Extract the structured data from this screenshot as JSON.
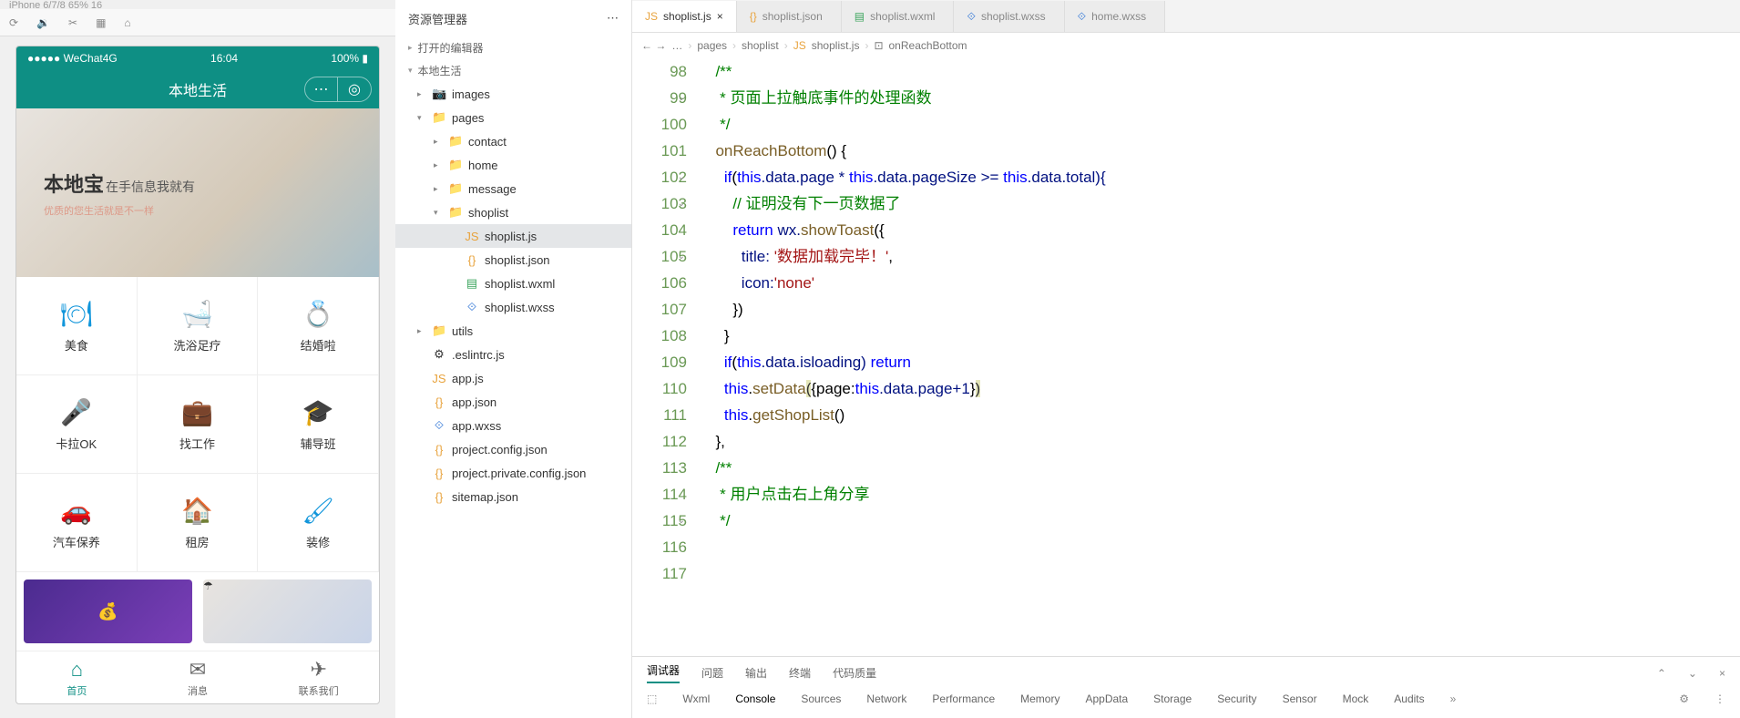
{
  "simulator": {
    "device_label": "iPhone 6/7/8 65% 16",
    "status_left": "●●●●● WeChat4G",
    "status_time": "16:04",
    "status_right": "100% ▮",
    "app_title": "本地生活",
    "banner": {
      "title": "本地宝",
      "sub": "在手信息我就有",
      "desc": "优质的您生活就是不一样"
    },
    "grid": [
      {
        "icon": "🍽",
        "label": "美食"
      },
      {
        "icon": "🛁",
        "label": "洗浴足疗"
      },
      {
        "icon": "💍",
        "label": "结婚啦"
      },
      {
        "icon": "🎤",
        "label": "卡拉OK"
      },
      {
        "icon": "💼",
        "label": "找工作"
      },
      {
        "icon": "🎓",
        "label": "辅导班"
      },
      {
        "icon": "🚗",
        "label": "汽车保养"
      },
      {
        "icon": "🏠",
        "label": "租房"
      },
      {
        "icon": "🖌",
        "label": "装修"
      }
    ],
    "tabs": [
      {
        "icon": "⌂",
        "label": "首页",
        "active": true
      },
      {
        "icon": "✉",
        "label": "消息",
        "active": false
      },
      {
        "icon": "✈",
        "label": "联系我们",
        "active": false
      }
    ]
  },
  "explorer": {
    "title": "资源管理器",
    "section_editors": "打开的编辑器",
    "project": "本地生活",
    "tree": [
      {
        "d": 1,
        "chev": "▸",
        "ic": "📷",
        "cls": "fic-img",
        "name": "images"
      },
      {
        "d": 1,
        "chev": "▾",
        "ic": "📁",
        "cls": "fic-folder",
        "name": "pages"
      },
      {
        "d": 2,
        "chev": "▸",
        "ic": "📁",
        "cls": "fic-folder",
        "name": "contact"
      },
      {
        "d": 2,
        "chev": "▸",
        "ic": "📁",
        "cls": "fic-folder",
        "name": "home"
      },
      {
        "d": 2,
        "chev": "▸",
        "ic": "📁",
        "cls": "fic-folder",
        "name": "message"
      },
      {
        "d": 2,
        "chev": "▾",
        "ic": "📁",
        "cls": "fic-folder",
        "name": "shoplist"
      },
      {
        "d": 3,
        "chev": "",
        "ic": "JS",
        "cls": "fic-js",
        "name": "shoplist.js",
        "sel": true
      },
      {
        "d": 3,
        "chev": "",
        "ic": "{}",
        "cls": "fic-json",
        "name": "shoplist.json"
      },
      {
        "d": 3,
        "chev": "",
        "ic": "▤",
        "cls": "fic-wxml",
        "name": "shoplist.wxml"
      },
      {
        "d": 3,
        "chev": "",
        "ic": "⟐",
        "cls": "fic-wxss",
        "name": "shoplist.wxss"
      },
      {
        "d": 1,
        "chev": "▸",
        "ic": "📁",
        "cls": "fic-folder",
        "name": "utils"
      },
      {
        "d": 1,
        "chev": "",
        "ic": "⚙",
        "cls": "",
        "name": ".eslintrc.js"
      },
      {
        "d": 1,
        "chev": "",
        "ic": "JS",
        "cls": "fic-js",
        "name": "app.js"
      },
      {
        "d": 1,
        "chev": "",
        "ic": "{}",
        "cls": "fic-json",
        "name": "app.json"
      },
      {
        "d": 1,
        "chev": "",
        "ic": "⟐",
        "cls": "fic-wxss",
        "name": "app.wxss"
      },
      {
        "d": 1,
        "chev": "",
        "ic": "{}",
        "cls": "fic-json",
        "name": "project.config.json"
      },
      {
        "d": 1,
        "chev": "",
        "ic": "{}",
        "cls": "fic-json",
        "name": "project.private.config.json"
      },
      {
        "d": 1,
        "chev": "",
        "ic": "{}",
        "cls": "fic-json",
        "name": "sitemap.json"
      }
    ]
  },
  "editor": {
    "tabs": [
      {
        "ic": "JS",
        "cls": "fic-js",
        "name": "shoplist.js",
        "close": "×",
        "active": true
      },
      {
        "ic": "{}",
        "cls": "fic-json",
        "name": "shoplist.json",
        "close": ""
      },
      {
        "ic": "▤",
        "cls": "fic-wxml",
        "name": "shoplist.wxml",
        "close": ""
      },
      {
        "ic": "⟐",
        "cls": "fic-wxss",
        "name": "shoplist.wxss",
        "close": ""
      },
      {
        "ic": "⟐",
        "cls": "fic-wxss",
        "name": "home.wxss",
        "close": ""
      }
    ],
    "crumbs": {
      "arrows": "← →",
      "p0": "…",
      "p1": "pages",
      "p2": "shoplist",
      "p3": "shoplist.js",
      "p4": "onReachBottom"
    },
    "lines": {
      "start": 98,
      "c98": "",
      "c99": "  /**",
      "c100": "   * 页面上拉触底事件的处理函数",
      "c101": "   */",
      "c102_a": "onReachBottom",
      "c102_b": "()",
      "c102_c": " {",
      "c103_a": "if",
      "c103_b": "(",
      "c103_c": "this",
      "c103_d": ".data.page * ",
      "c103_e": "this",
      "c103_f": ".data.pageSize >= ",
      "c103_g": "this",
      "c103_h": ".data.total){",
      "c104": "// 证明没有下一页数据了",
      "c105_a": "return",
      "c105_b": " wx.",
      "c105_c": "showToast",
      "c105_d": "({",
      "c106_a": "title:",
      "c106_b": " '数据加载完毕！'",
      "c106_c": ",",
      "c107_a": "icon:",
      "c107_b": "'none'",
      "c108": "})",
      "c109": "}",
      "c110_a": "if",
      "c110_b": "(",
      "c110_c": "this",
      "c110_d": ".data.isloading) ",
      "c110_e": "return",
      "c111_a": "this",
      "c111_b": ".",
      "c111_c": "setData",
      "c111_d": "(",
      "c111_e": "{page:",
      "c111_f": "this",
      "c111_g": ".data.page+",
      "c111_h": "1",
      "c111_i": "}",
      "c111_j": ")",
      "c112_a": "this",
      "c112_b": ".",
      "c112_c": "getShopList",
      "c112_d": "()",
      "c113": "},",
      "c114": "",
      "c115": "  /**",
      "c116": "   * 用户点击右上角分享",
      "c117": "   */"
    }
  },
  "devtools": {
    "row1": [
      "调试器",
      "问题",
      "输出",
      "终端",
      "代码质量"
    ],
    "row2": [
      "Wxml",
      "Console",
      "Sources",
      "Network",
      "Performance",
      "Memory",
      "AppData",
      "Storage",
      "Security",
      "Sensor",
      "Mock",
      "Audits"
    ]
  }
}
